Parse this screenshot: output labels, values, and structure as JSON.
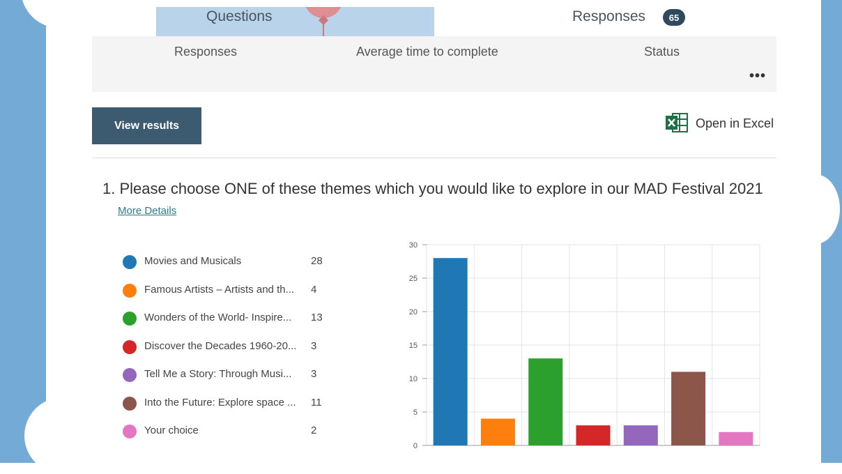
{
  "header": {
    "tab_questions": "Questions",
    "tab_responses": "Responses",
    "responses_count": "65"
  },
  "stats": {
    "responses_label": "Responses",
    "avg_time_label": "Average time to complete",
    "status_label": "Status",
    "more_icon": "ellipsis-icon",
    "more_symbol": "•••"
  },
  "actions": {
    "view_results": "View results",
    "open_excel": "Open in Excel",
    "excel_icon": "excel-icon"
  },
  "question": {
    "title": "1.  Please choose ONE of these themes which you would like to explore in our MAD Festival 2021",
    "more_details": "More Details"
  },
  "legend": [
    {
      "label": "Movies and Musicals",
      "count": "28",
      "color": "#1f77b4"
    },
    {
      "label": "Famous Artists – Artists and th...",
      "count": "4",
      "color": "#ff7f0e"
    },
    {
      "label": "Wonders of the World- Inspire...",
      "count": "13",
      "color": "#2ca02c"
    },
    {
      "label": "Discover the Decades 1960-20...",
      "count": "3",
      "color": "#d62728"
    },
    {
      "label": "Tell Me a Story: Through Musi...",
      "count": "3",
      "color": "#9467bd"
    },
    {
      "label": "Into the Future: Explore space ...",
      "count": "11",
      "color": "#8c564b"
    },
    {
      "label": "Your choice",
      "count": "2",
      "color": "#e377c2"
    }
  ],
  "chart_data": {
    "type": "bar",
    "categories": [
      "Movies and Musicals",
      "Famous Artists – Artists and th...",
      "Wonders of the World- Inspire...",
      "Discover the Decades 1960-20...",
      "Tell Me a Story: Through Musi...",
      "Into the Future: Explore space ...",
      "Your choice"
    ],
    "values": [
      28,
      4,
      13,
      3,
      3,
      11,
      2
    ],
    "colors": [
      "#1f77b4",
      "#ff7f0e",
      "#2ca02c",
      "#d62728",
      "#9467bd",
      "#8c564b",
      "#e377c2"
    ],
    "ylim": [
      0,
      30
    ],
    "yticks": [
      0,
      5,
      10,
      15,
      20,
      25,
      30
    ],
    "grid": true,
    "xlabel": "",
    "ylabel": "",
    "title": ""
  }
}
